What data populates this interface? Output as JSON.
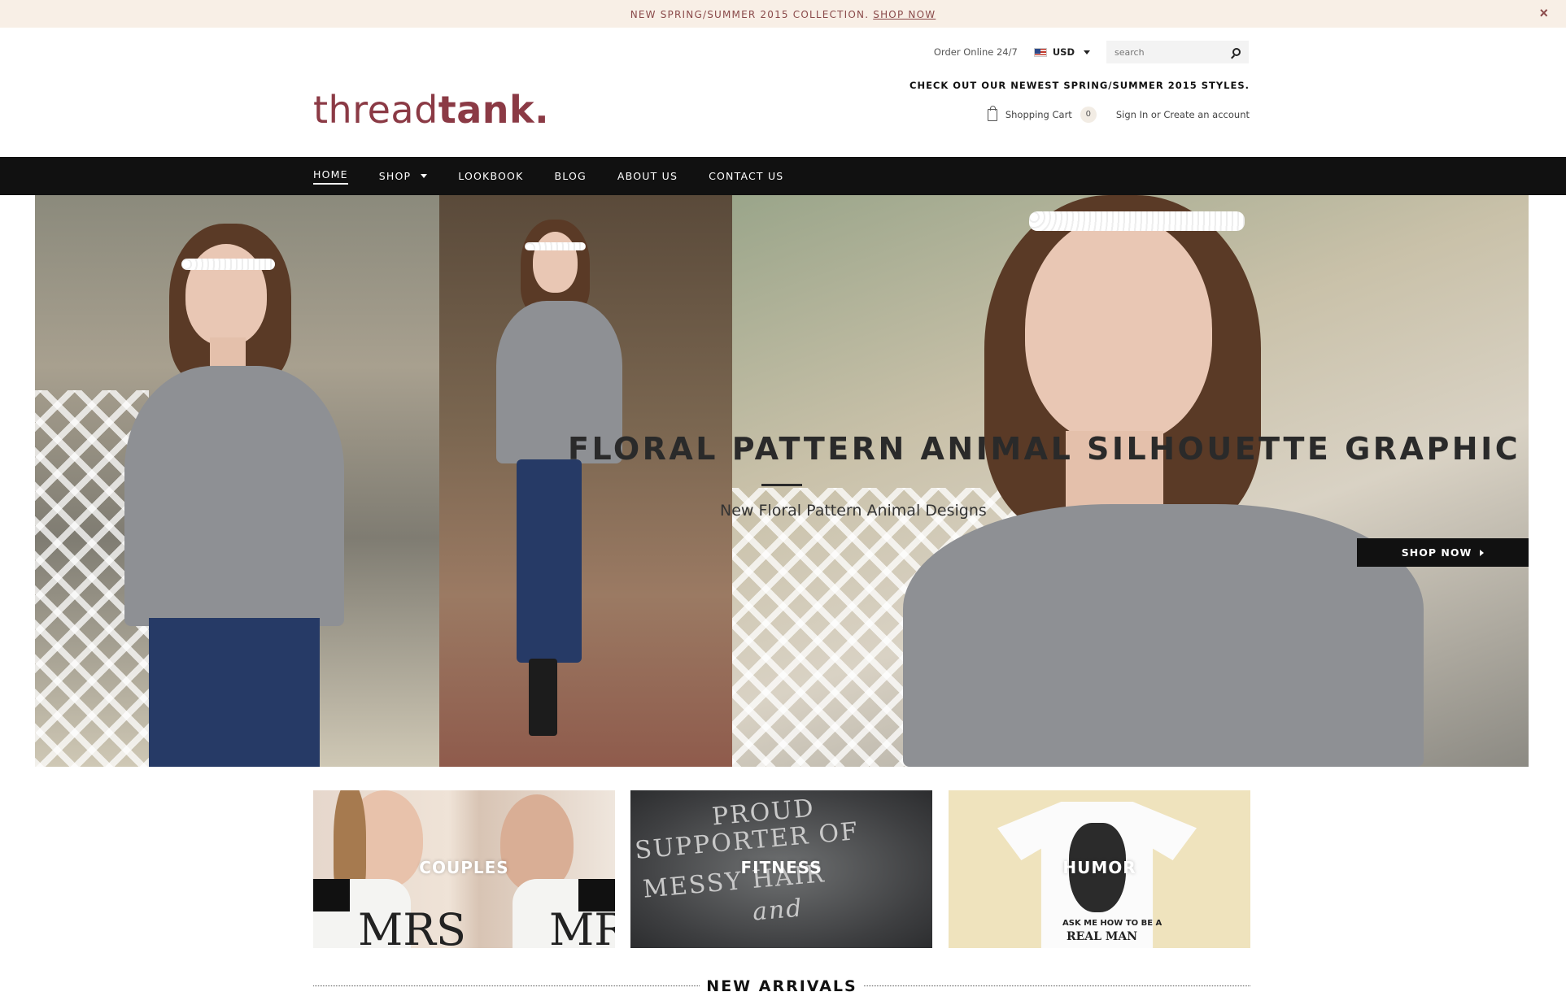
{
  "announcement": {
    "text": "NEW SPRING/SUMMER 2015 COLLECTION.",
    "link": "SHOP NOW",
    "close": "×"
  },
  "header": {
    "logo_light": "thread",
    "logo_bold": "tank.",
    "order_online": "Order Online 24/7",
    "currency": "USD",
    "search_placeholder": "search",
    "tagline": "CHECK OUT OUR NEWEST SPRING/SUMMER 2015 STYLES.",
    "cart_label": "Shopping Cart",
    "cart_count": "0",
    "signin": "Sign In or Create an account"
  },
  "nav": {
    "items": [
      {
        "label": "HOME"
      },
      {
        "label": "SHOP"
      },
      {
        "label": "LOOKBOOK"
      },
      {
        "label": "BLOG"
      },
      {
        "label": "ABOUT US"
      },
      {
        "label": "CONTACT US"
      }
    ]
  },
  "hero": {
    "title": "FLORAL PATTERN ANIMAL SILHOUETTE GRAPHIC TEES",
    "subtitle": "New Floral Pattern Animal Designs",
    "button": "SHOP NOW"
  },
  "categories": [
    {
      "label": "COUPLES"
    },
    {
      "label": "FITNESS"
    },
    {
      "label": "HUMOR"
    }
  ],
  "new_arrivals": {
    "title": "NEW ARRIVALS"
  },
  "colors": {
    "brand": "#8b3a45",
    "announce_bg": "#f8efe6",
    "nav_bg": "#111111"
  }
}
